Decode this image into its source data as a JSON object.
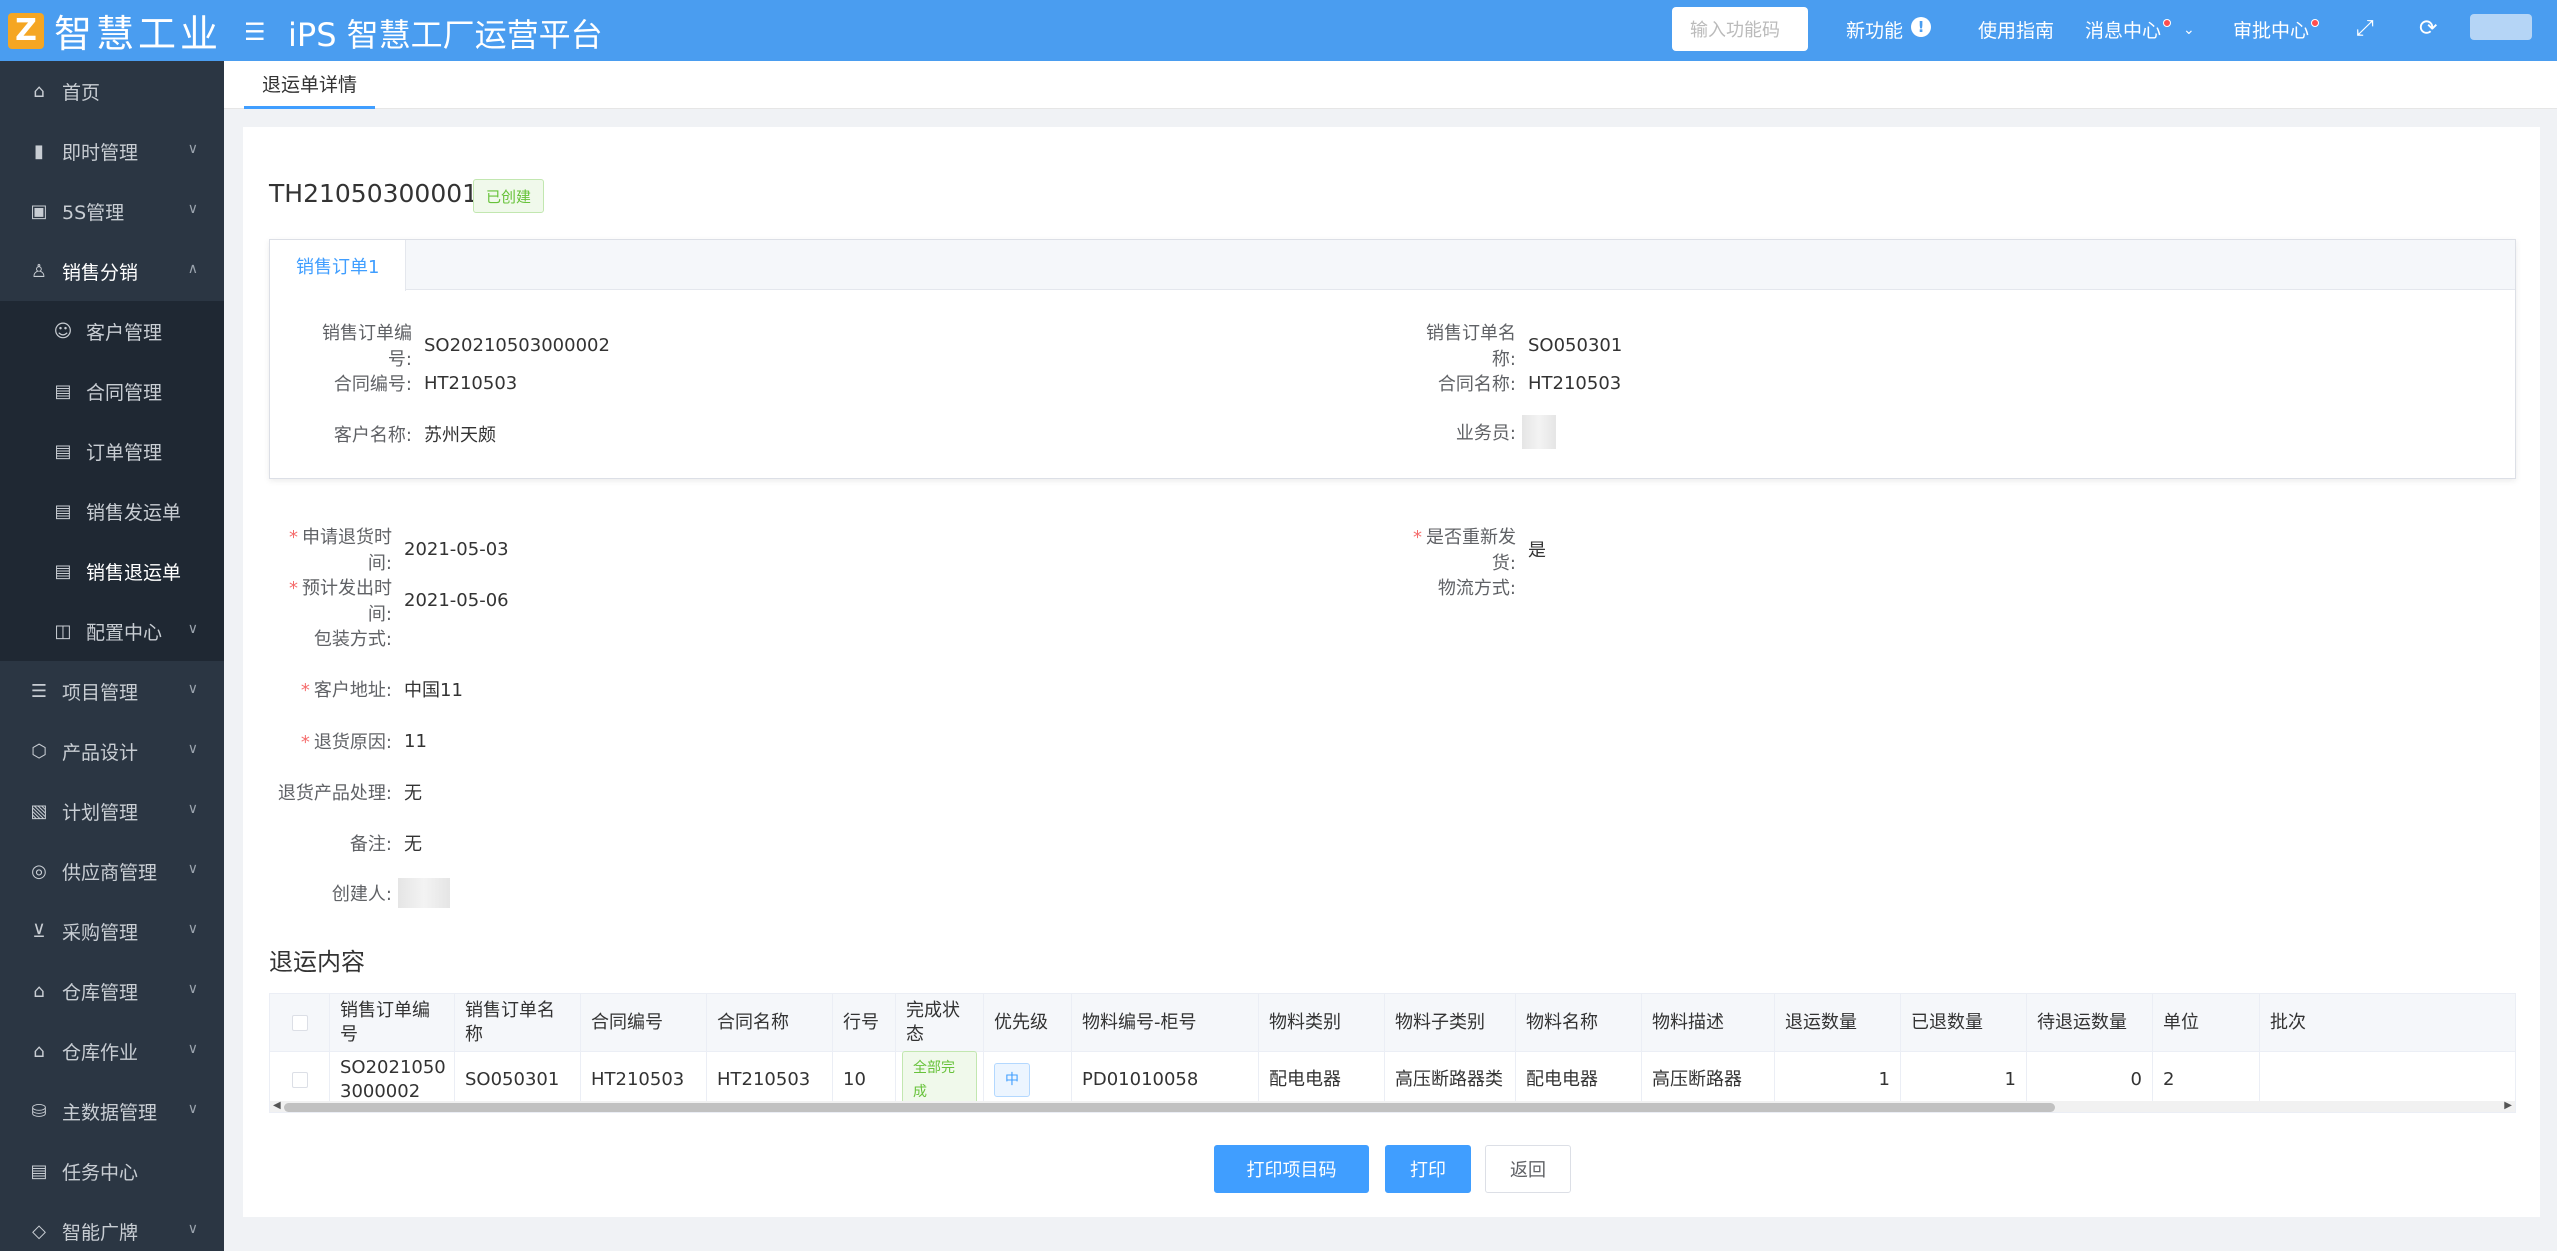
{
  "header": {
    "logo_text": "智慧工业",
    "app_title": "iPS 智慧工厂运营平台",
    "search_placeholder": "输入功能码",
    "nav": {
      "new_features": "新功能",
      "guide": "使用指南",
      "messages": "消息中心",
      "approvals": "审批中心"
    }
  },
  "sidebar": {
    "items": [
      {
        "label": "首页",
        "icon": "home-icon"
      },
      {
        "label": "即时管理",
        "icon": "bar-chart-icon"
      },
      {
        "label": "5S管理",
        "icon": "5s-icon"
      },
      {
        "label": "销售分销",
        "icon": "user-icon"
      },
      {
        "label": "客户管理",
        "icon": "customers-icon"
      },
      {
        "label": "合同管理",
        "icon": "contract-icon"
      },
      {
        "label": "订单管理",
        "icon": "order-icon"
      },
      {
        "label": "销售发运单",
        "icon": "shipment-icon"
      },
      {
        "label": "销售退运单",
        "icon": "return-icon"
      },
      {
        "label": "配置中心",
        "icon": "config-icon"
      },
      {
        "label": "项目管理",
        "icon": "project-icon"
      },
      {
        "label": "产品设计",
        "icon": "cube-icon"
      },
      {
        "label": "计划管理",
        "icon": "plan-icon"
      },
      {
        "label": "供应商管理",
        "icon": "supplier-icon"
      },
      {
        "label": "采购管理",
        "icon": "cart-icon"
      },
      {
        "label": "仓库管理",
        "icon": "warehouse-icon"
      },
      {
        "label": "仓库作业",
        "icon": "warehouse-op-icon"
      },
      {
        "label": "主数据管理",
        "icon": "master-data-icon"
      },
      {
        "label": "任务中心",
        "icon": "task-icon"
      },
      {
        "label": "智能广牌",
        "icon": "tag-icon"
      }
    ]
  },
  "tabs": {
    "active": "退运单详情"
  },
  "detail": {
    "order_no": "TH21050300001",
    "status": "已创建",
    "sub_tab": "销售订单1",
    "sales_order": {
      "no_label": "销售订单编号:",
      "no_value": "SO20210503000002",
      "name_label": "销售订单名称:",
      "name_value": "SO050301",
      "contract_no_label": "合同编号:",
      "contract_no_value": "HT210503",
      "contract_name_label": "合同名称:",
      "contract_name_value": "HT210503",
      "customer_label": "客户名称:",
      "customer_value": "苏州天颇",
      "salesman_label": "业务员:"
    },
    "fields": {
      "apply_time_label": "申请退货时间:",
      "apply_time_value": "2021-05-03",
      "reship_label": "是否重新发货:",
      "reship_value": "是",
      "est_ship_label": "预计发出时间:",
      "est_ship_value": "2021-05-06",
      "logistics_label": "物流方式:",
      "packing_label": "包装方式:",
      "address_label": "客户地址:",
      "address_value": "中国11",
      "reason_label": "退货原因:",
      "reason_value": "11",
      "handling_label": "退货产品处理:",
      "handling_value": "无",
      "remark_label": "备注:",
      "remark_value": "无",
      "creator_label": "创建人:"
    }
  },
  "section_title": "退运内容",
  "table": {
    "headers": [
      "销售订单编号",
      "销售订单名称",
      "合同编号",
      "合同名称",
      "行号",
      "完成状态",
      "优先级",
      "物料编号-柜号",
      "物料类别",
      "物料子类别",
      "物料名称",
      "物料描述",
      "退运数量",
      "已退数量",
      "待退运数量",
      "单位",
      "批次"
    ],
    "rows": [
      [
        "SO2021050 3000002",
        "SO050301",
        "HT210503",
        "HT210503",
        "10",
        "全部完成",
        "中",
        "PD01010058",
        "配电电器",
        "高压断路器类",
        "配电电器",
        "高压断路器",
        "1",
        "1",
        "0",
        "2",
        ""
      ]
    ]
  },
  "buttons": {
    "print_code": "打印项目码",
    "print": "打印",
    "back": "返回"
  }
}
